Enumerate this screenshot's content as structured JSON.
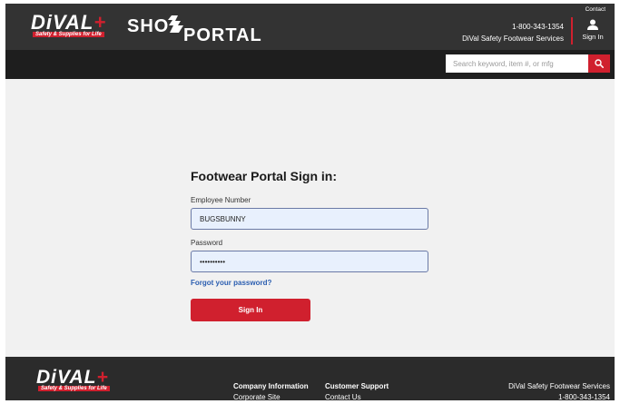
{
  "header": {
    "logo_text": "DiVAL",
    "logo_tagline": "Safety & Supplies for Life",
    "portal_title_left": "SHO",
    "portal_title_right": "PORTAL",
    "contact_label": "Contact",
    "phone": "1-800-343-1354",
    "service_name": "DiVal Safety Footwear Services",
    "signin_label": "Sign In"
  },
  "search": {
    "placeholder": "Search keyword, item #, or mfg",
    "icon": "search-icon"
  },
  "login_form": {
    "title": "Footwear Portal Sign in:",
    "employee_label": "Employee Number",
    "employee_value": "BUGSBUNNY",
    "password_label": "Password",
    "password_value": "••••••••••",
    "forgot_link": "Forgot your password?",
    "submit_label": "Sign In"
  },
  "footer": {
    "logo_text": "DiVAL",
    "logo_tagline": "Safety & Supplies for Life",
    "col1_heading": "Company Information",
    "col1_link": "Corporate Site",
    "col2_heading": "Customer Support",
    "col2_link": "Contact Us",
    "col3_heading": "DiVal Safety Footwear Services",
    "col3_phone": "1-800-343-1354"
  },
  "colors": {
    "brand_red": "#d0202e",
    "header_bg": "#333333",
    "nav_bg": "#1e1e1e",
    "footer_bg": "#2b2b2b",
    "link_blue": "#2a5db0"
  }
}
